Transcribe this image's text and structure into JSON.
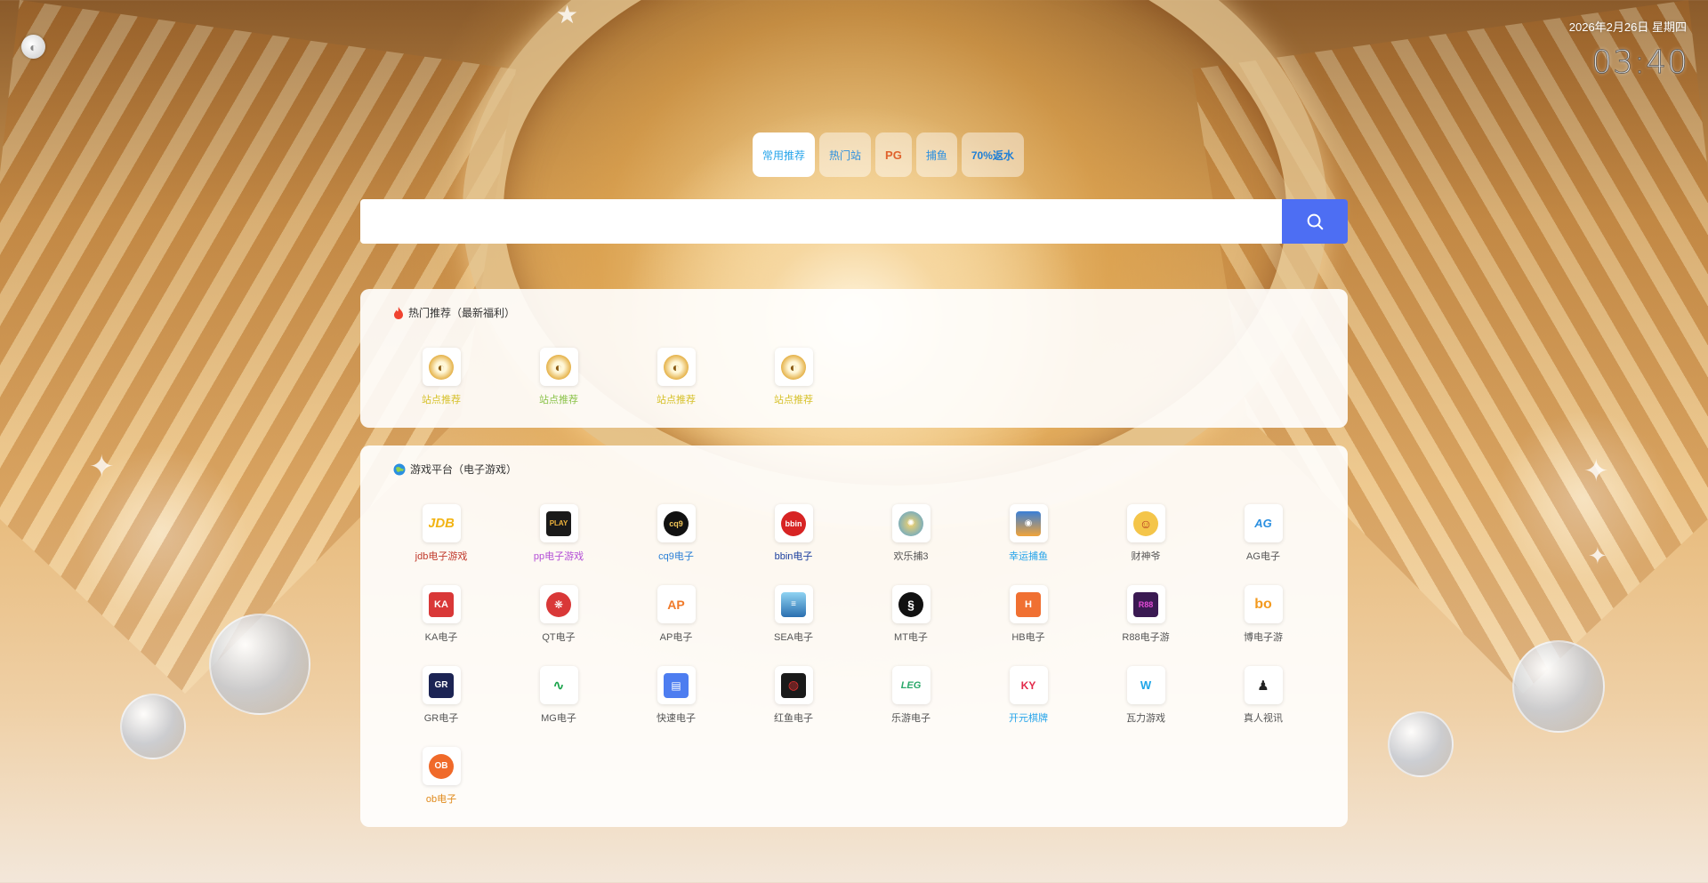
{
  "header": {
    "date": "2026年2月26日 星期四",
    "time": "03:40"
  },
  "tabs": [
    {
      "label": "常用推荐",
      "style": "active"
    },
    {
      "label": "热门站",
      "style": ""
    },
    {
      "label": "PG",
      "style": "pg"
    },
    {
      "label": "捕鱼",
      "style": ""
    },
    {
      "label": "70%返水",
      "style": "hi"
    }
  ],
  "search": {
    "placeholder": "",
    "button_icon": "search-icon",
    "button_color": "#4d6ef3"
  },
  "panel_hot": {
    "title": "热门推荐（最新福利）",
    "title_icon": "fire-icon",
    "items": [
      {
        "label": "站点推荐",
        "color": "#d6c12a",
        "icon": "gold-coin-icon"
      },
      {
        "label": "站点推荐",
        "color": "#8bc34a",
        "icon": "gold-coin-icon"
      },
      {
        "label": "站点推荐",
        "color": "#d6c12a",
        "icon": "gold-coin-icon"
      },
      {
        "label": "站点推荐",
        "color": "#d6c12a",
        "icon": "gold-coin-icon"
      }
    ]
  },
  "panel_platforms": {
    "title": "游戏平台（电子游戏）",
    "title_icon": "globe-icon",
    "items": [
      {
        "label": "jdb电子游戏",
        "color": "#c0392b",
        "icon": "jdb-logo-icon"
      },
      {
        "label": "pp电子游戏",
        "color": "#b44fd6",
        "icon": "pp-logo-icon"
      },
      {
        "label": "cq9电子",
        "color": "#2a7fd6",
        "icon": "cq9-logo-icon"
      },
      {
        "label": "bbin电子",
        "color": "#1b3f9e",
        "icon": "bbin-logo-icon"
      },
      {
        "label": "欢乐捕3",
        "color": "#555555",
        "icon": "fishing-logo-icon"
      },
      {
        "label": "幸运捕鱼",
        "color": "#26a4ea",
        "icon": "fish-game-logo-icon"
      },
      {
        "label": "财神爷",
        "color": "#555555",
        "icon": "fortune-god-icon"
      },
      {
        "label": "AG电子",
        "color": "#555555",
        "icon": "ag-logo-icon"
      },
      {
        "label": "KA电子",
        "color": "#555555",
        "icon": "ka-logo-icon"
      },
      {
        "label": "QT电子",
        "color": "#555555",
        "icon": "qt-logo-icon"
      },
      {
        "label": "AP电子",
        "color": "#555555",
        "icon": "ap-logo-icon"
      },
      {
        "label": "SEA电子",
        "color": "#555555",
        "icon": "sea-logo-icon"
      },
      {
        "label": "MT电子",
        "color": "#555555",
        "icon": "mt-swan-logo-icon"
      },
      {
        "label": "HB电子",
        "color": "#555555",
        "icon": "hb-logo-icon"
      },
      {
        "label": "R88电子游",
        "color": "#555555",
        "icon": "r88-logo-icon"
      },
      {
        "label": "博电子游",
        "color": "#555555",
        "icon": "bo-logo-icon"
      },
      {
        "label": "GR电子",
        "color": "#555555",
        "icon": "gr-logo-icon"
      },
      {
        "label": "MG电子",
        "color": "#555555",
        "icon": "mg-logo-icon"
      },
      {
        "label": "快速电子",
        "color": "#555555",
        "icon": "document-logo-icon"
      },
      {
        "label": "红鱼电子",
        "color": "#555555",
        "icon": "red-circle-logo-icon"
      },
      {
        "label": "乐游电子",
        "color": "#555555",
        "icon": "leg-logo-icon"
      },
      {
        "label": "开元棋牌",
        "color": "#26a4ea",
        "icon": "ky-logo-icon"
      },
      {
        "label": "瓦力游戏",
        "color": "#555555",
        "icon": "wali-logo-icon"
      },
      {
        "label": "真人视讯",
        "color": "#555555",
        "icon": "live-dealer-icon"
      },
      {
        "label": "ob电子",
        "color": "#e08a1c",
        "icon": "ob-logo-icon"
      }
    ]
  }
}
